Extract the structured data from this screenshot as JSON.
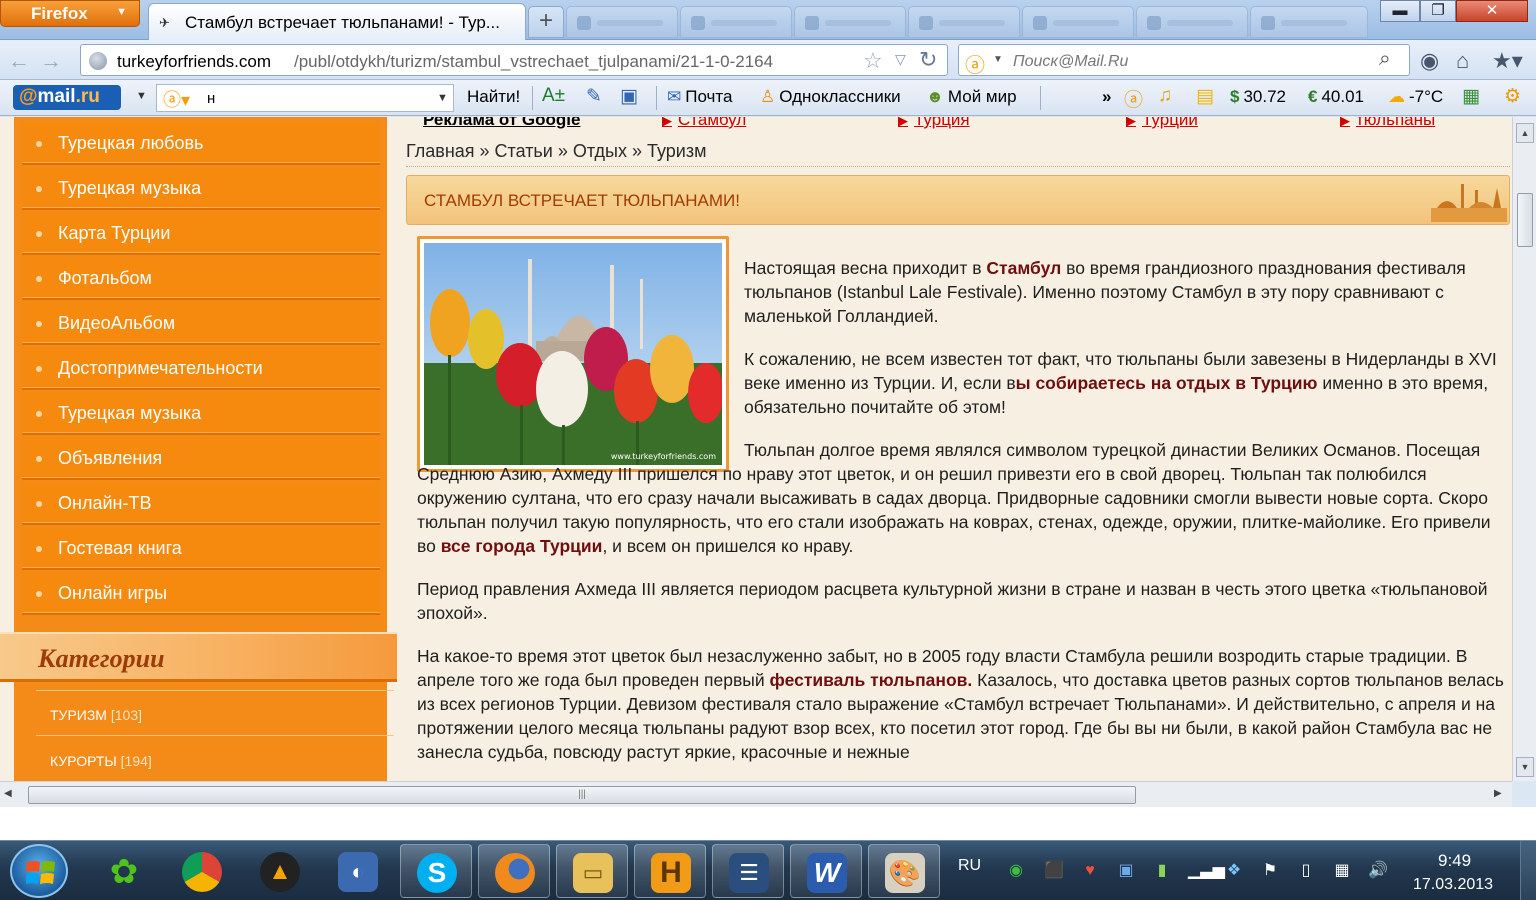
{
  "browser": {
    "menu_button": "Firefox",
    "tab_title": "Стамбул встречает тюльпанами! - Тур...",
    "new_tab": "+",
    "url_host": "turkeyforfriends.com",
    "url_path": "/publ/otdykh/turizm/stambul_vstrechaet_tjulpanami/21-1-0-2164",
    "search_placeholder": "Поиск@Mail.Ru",
    "win_min": "▬",
    "win_max": "❐",
    "win_close": "✕"
  },
  "mailbar": {
    "logo_at": "@",
    "logo_mail": "mail",
    "logo_ru": ".ru",
    "search_value": "н",
    "find": "Найти!",
    "mail": "Почта",
    "ok": "Одноклассники",
    "myworld": "Мой мир",
    "more": "»",
    "usd": "30.72",
    "eur": "40.01",
    "weather": "-7°C",
    "usd_sign": "$",
    "eur_sign": "€"
  },
  "sidebar": {
    "menu": [
      "Турецкая любовь",
      "Турецкая музыка",
      "Карта Турции",
      "Фотальбом",
      "ВидеоАльбом",
      "Достопримечательности",
      "Турецкая музыка",
      "Объявления",
      "Онлайн-ТВ",
      "Гостевая книга",
      "Онлайн игры"
    ],
    "categories_title": "Категории",
    "categories": [
      {
        "name": "ТУРИЗМ",
        "count": "[103]"
      },
      {
        "name": "КУРОРТЫ",
        "count": "[194]"
      }
    ]
  },
  "content": {
    "ads_label": "Реклама от Google",
    "ads": [
      "Стамбул",
      "Турция",
      "Турции",
      "тюльпаны"
    ],
    "breadcrumb": [
      "Главная",
      "Статьи",
      "Отдых",
      "Туризм"
    ],
    "crumb_sep": " » ",
    "title": "СТАМБУЛ ВСТРЕЧАЕТ ТЮЛЬПАНАМИ!",
    "photo_caption": "www.turkeyforfriends.com",
    "p1": [
      "Настоящая весна приходит в ",
      "Стамбул",
      " во время грандиозного празднования фестиваля тюльпанов (Istanbul Lale Festivale). Именно поэтому Стамбул в эту пору сравнивают с маленькой Голландией."
    ],
    "p2": [
      "К сожалению, не всем известен тот факт, что тюльпаны были завезены в Нидерланды в XVI веке именно из Турции. И, если в",
      "ы собираетесь на отдых в Турцию",
      " именно в это время, обязательно почитайте об этом!"
    ],
    "p3": [
      "Тюльпан долгое время являлся символом турецкой династии Великих Османов. Посещая Среднюю Азию, Ахмеду III пришелся по нраву этот цветок, и он решил привезти его в свой дворец. Тюльпан так полюбился окружению султана, что его сразу начали высаживать в садах дворца. Придворные садовники смогли вывести новые сорта. Скоро тюльпан получил такую популярность, что его стали изображать на коврах, стенах, одежде, оружии, плитке-майолике. Его привели во ",
      "все города Турции",
      ", и всем он пришелся ко нраву."
    ],
    "p4": "Период правления Ахмеда III является периодом расцвета культурной жизни в стране и назван в честь этого цветка «тюльпановой эпохой».",
    "p5": [
      "На какое-то время этот цветок был незаслуженно забыт, но в 2005 году власти Стамбула решили возродить старые традиции. В апреле того же года был проведен первый ",
      "фестиваль тюльпанов.",
      " Казалось, что доставка цветов разных сортов тюльпанов велась из всех регионов Турции. Девизом фестиваля стало выражение «Стамбул встречает Тюльпанами». И действительно, с апреля и на протяжении целого месяца тюльпаны радуют взор всех, кто посетил этот город. Где бы вы ни были, в какой район Стамбула вас не занесла судьба, повсюду растут яркие, красочные и нежные"
    ]
  },
  "taskbar": {
    "lang": "RU",
    "time": "9:49",
    "date": "17.03.2013"
  }
}
